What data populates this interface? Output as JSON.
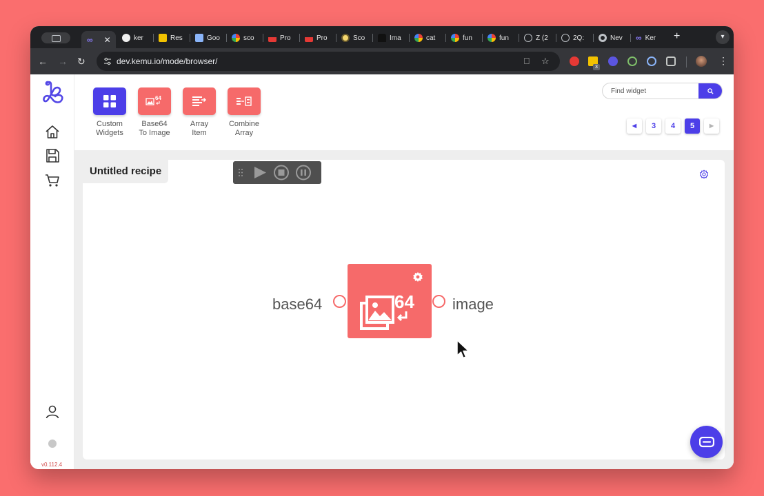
{
  "browser": {
    "tabs": [
      {
        "label": "",
        "favicon": "kemu-icon",
        "active": true
      },
      {
        "label": "ker",
        "favicon": "github-icon"
      },
      {
        "label": "Res",
        "favicon": "bookmark-icon"
      },
      {
        "label": "Goo",
        "favicon": "google-docs-icon"
      },
      {
        "label": "sco",
        "favicon": "google-icon"
      },
      {
        "label": "Pro",
        "favicon": "app-icon"
      },
      {
        "label": "Pro",
        "favicon": "app-icon"
      },
      {
        "label": "Sco",
        "favicon": "eye-icon"
      },
      {
        "label": "Ima",
        "favicon": "figure-icon"
      },
      {
        "label": "cat",
        "favicon": "google-icon"
      },
      {
        "label": "fun",
        "favicon": "google-icon"
      },
      {
        "label": "fun",
        "favicon": "google-icon"
      },
      {
        "label": "Z (2",
        "favicon": "globe-icon"
      },
      {
        "label": "2Q:",
        "favicon": "globe-icon"
      },
      {
        "label": "Nev",
        "favicon": "chrome-icon"
      },
      {
        "label": "Ker",
        "favicon": "kemu-icon"
      }
    ],
    "new_tab_label": "+",
    "url": "dev.kemu.io/mode/browser/",
    "extension_badge": "3"
  },
  "app": {
    "version": "v0.112.4",
    "widgets": [
      {
        "label_line1": "Custom",
        "label_line2": "Widgets",
        "icon": "grid-icon",
        "color": "#4c3ee8"
      },
      {
        "label_line1": "Base64",
        "label_line2": "To Image",
        "icon": "base64-image-icon",
        "color": "#f66a6a"
      },
      {
        "label_line1": "Array",
        "label_line2": "Item",
        "icon": "array-item-icon",
        "color": "#f66a6a"
      },
      {
        "label_line1": "Combine",
        "label_line2": "Array",
        "icon": "combine-array-icon",
        "color": "#f66a6a"
      }
    ],
    "search": {
      "placeholder": "Find widget"
    },
    "pagination": {
      "pages": [
        "3",
        "4",
        "5"
      ],
      "current": "5"
    },
    "recipe": {
      "title": "Untitled recipe"
    },
    "node": {
      "input_label": "base64",
      "output_label": "image",
      "badge": "64",
      "color": "#f66a6a"
    },
    "colors": {
      "accent": "#4c3ee8",
      "widget": "#f66a6a",
      "background": "#fa6e6e"
    }
  }
}
